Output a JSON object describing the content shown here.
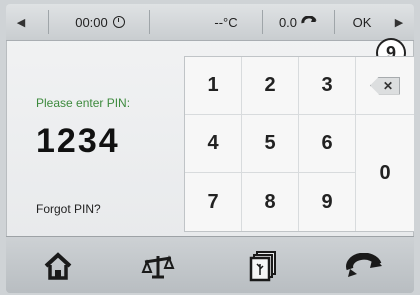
{
  "status_bar": {
    "left_arrow": "◀",
    "time": "00:00",
    "clock_icon": "clock-icon",
    "temperature": "--°C",
    "rotation_value": "0.0",
    "rotation_icon": "rotation-icon",
    "ok_label": "OK",
    "right_arrow": "▶"
  },
  "step_badge": "9",
  "pin_prompt": "Please enter PIN:",
  "pin_value": "1234",
  "forgot_pin": "Forgot PIN?",
  "keypad": {
    "keys": [
      "1",
      "2",
      "3",
      "4",
      "5",
      "6",
      "7",
      "8",
      "9",
      "0"
    ],
    "backspace_symbol": "✕"
  },
  "bottom_nav": {
    "icons": [
      "home-icon",
      "balance-icon",
      "documents-icon",
      "rotation-icon"
    ]
  },
  "colors": {
    "prompt_green": "#3d8a3d",
    "screen_bg": "#eef0f1",
    "bar_bg": "#c9cdd0"
  }
}
